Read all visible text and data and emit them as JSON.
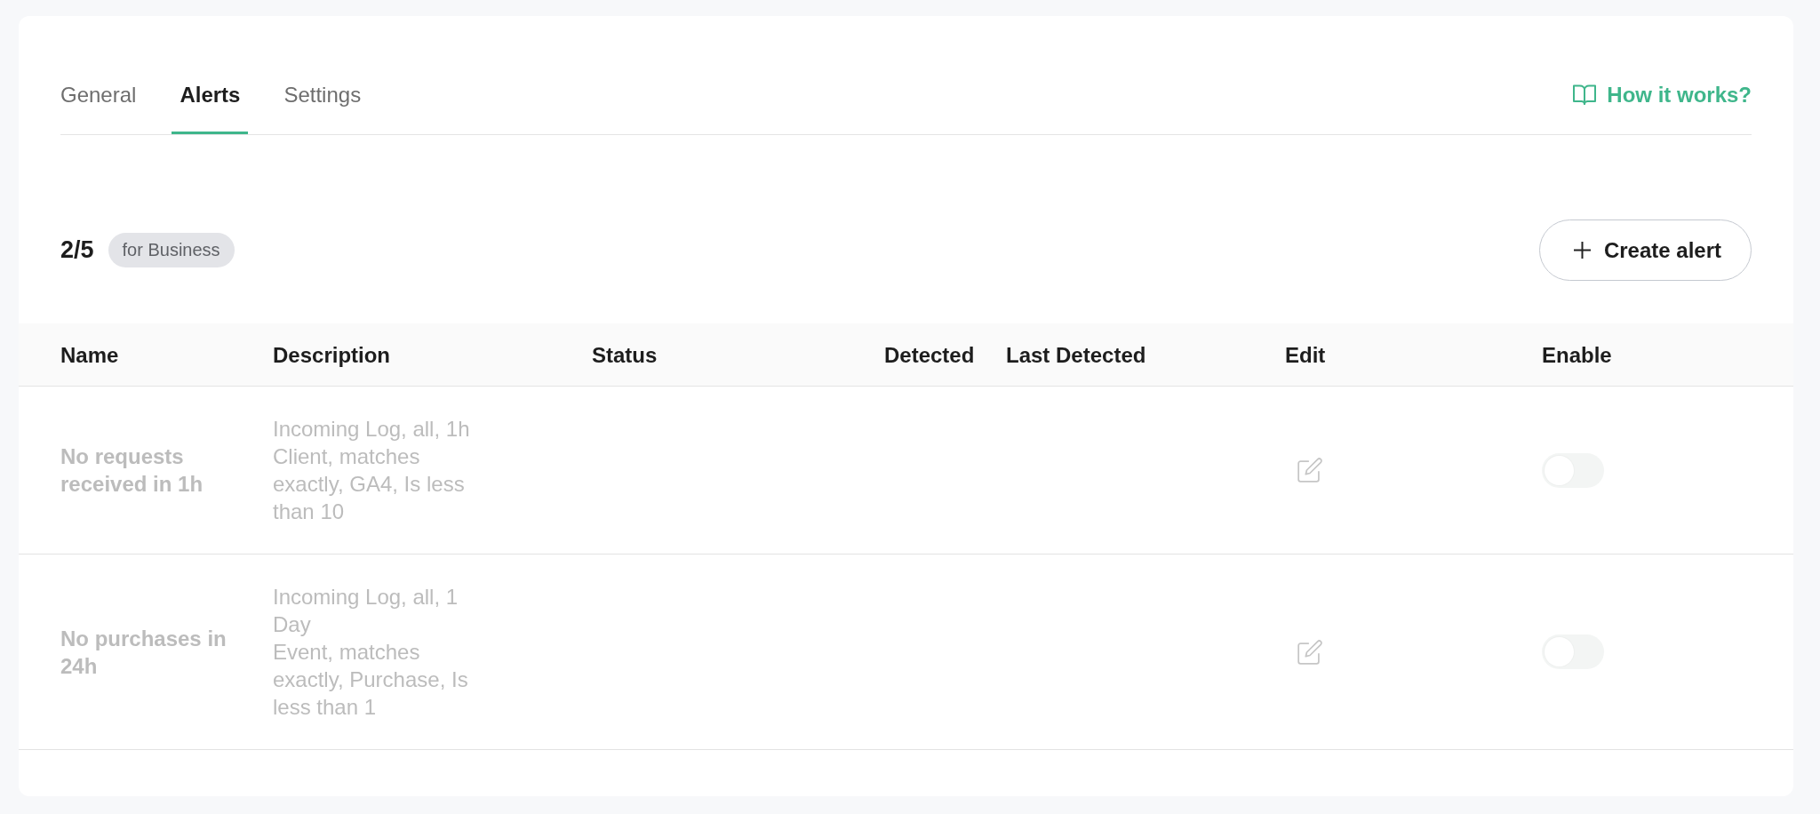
{
  "tabs": [
    {
      "label": "General",
      "selected": false
    },
    {
      "label": "Alerts",
      "selected": true
    },
    {
      "label": "Settings",
      "selected": false
    }
  ],
  "help_link": {
    "label": "How it works?"
  },
  "summary": {
    "count": "2/5",
    "plan_badge": "for Business"
  },
  "create_button": {
    "label": "Create alert"
  },
  "table": {
    "columns": [
      "Name",
      "Description",
      "Status",
      "Detected",
      "Last Detected",
      "Edit",
      "Enable"
    ],
    "rows": [
      {
        "name": "No requests received in 1h",
        "description": "Incoming Log, all, 1h\nClient, matches exactly, GA4, Is less than 10",
        "enabled": false
      },
      {
        "name": "No purchases in 24h",
        "description": "Incoming Log, all, 1 Day\nEvent, matches exactly, Purchase, Is less than 1",
        "enabled": false
      }
    ]
  }
}
